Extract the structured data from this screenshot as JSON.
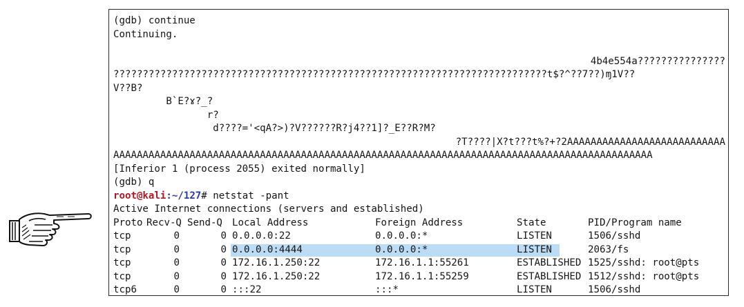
{
  "pointer": {
    "icon": "pointing-hand-icon"
  },
  "terminal": {
    "lines": [
      "(gdb) continue",
      "Continuing.",
      "",
      "4b4e554a???????????????",
      "??????????????????????????????????????????????????????????????????????????t$?^??7??)ɱ1V??",
      "V??B?",
      "         B`E?ɤ?_?",
      "                r?",
      "                 d????='<qA?>)?V??????R?j4??1]?_E??R?M?",
      "?T????|X?t???t%?+?2AAAAAAAAAAAAAAAAAAAAAAAAAAA",
      "AAAAAAAAAAAAAAAAAAAAAAAAAAAAAAAAAAAAAAAAAAAAAAAAAAAAAAAAAAAAAAAAAAAAAAAAAAAAAAAAAAAAAAAAAAAA",
      "[Inferior 1 (process 2055) exited normally]",
      "(gdb) q"
    ],
    "prompt": {
      "user_host": "root@kali",
      "path": ":~/127",
      "symbol": "#"
    },
    "command": " netstat -pant",
    "netstat_title": "Active Internet connections (servers and established)",
    "columns": [
      "Proto",
      "Recv-Q",
      "Send-Q",
      "Local Address",
      "Foreign Address",
      "State",
      "PID/Program name"
    ],
    "rows": [
      [
        "tcp",
        "0",
        "0",
        "0.0.0.0:22",
        "0.0.0.0:*",
        "LISTEN",
        "1506/sshd"
      ],
      [
        "tcp",
        "0",
        "0",
        "0.0.0.0:4444",
        "0.0.0.0:*",
        "LISTEN",
        "2063/fs"
      ],
      [
        "tcp",
        "0",
        "0",
        "172.16.1.250:22",
        "172.16.1.1:55261",
        "ESTABLISHED",
        "1525/sshd: root@pts"
      ],
      [
        "tcp",
        "0",
        "0",
        "172.16.1.250:22",
        "172.16.1.1:55259",
        "ESTABLISHED",
        "1512/sshd: root@pts"
      ],
      [
        "tcp6",
        "0",
        "0",
        ":::22",
        ":::*",
        "LISTEN",
        "1506/sshd"
      ]
    ],
    "colors": {
      "prompt_user": "#b0171f",
      "prompt_path": "#2b3aa8",
      "highlight": "#bcdcf6",
      "text": "#141414"
    }
  }
}
